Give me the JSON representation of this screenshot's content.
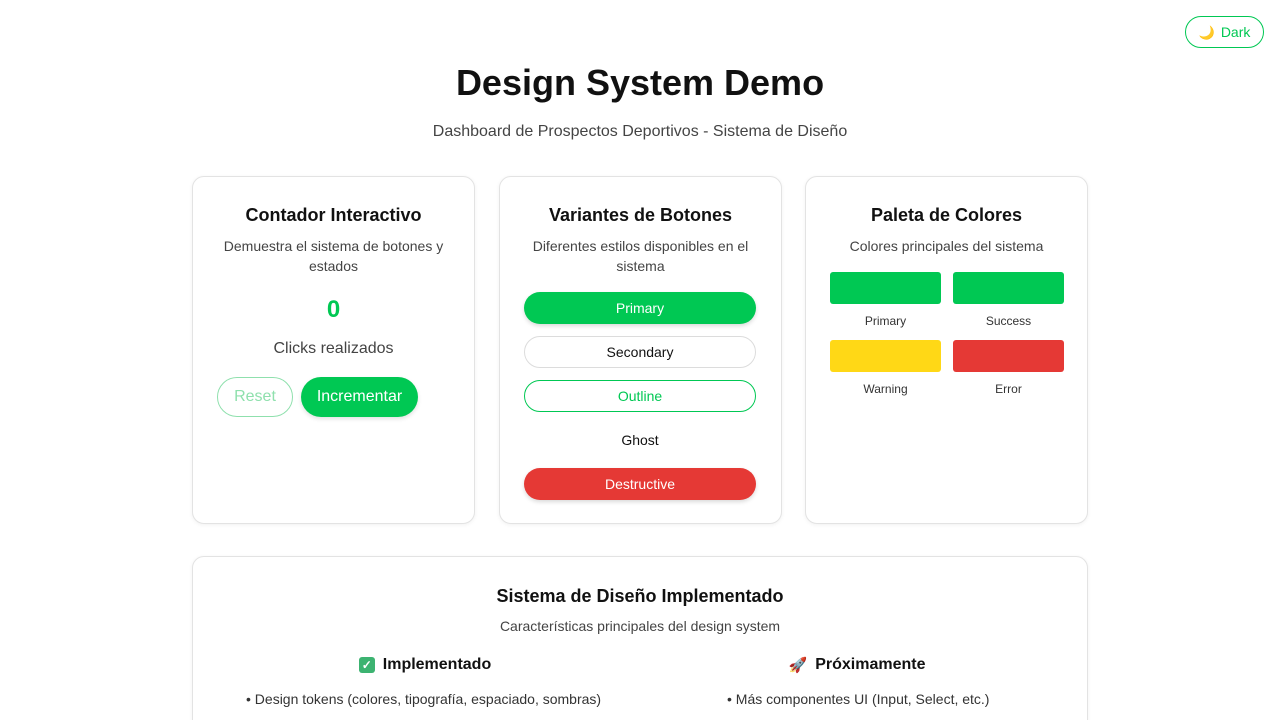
{
  "theme_toggle": {
    "icon": "moon-icon",
    "label": "Dark",
    "accent": "#00c853"
  },
  "header": {
    "title": "Design System Demo",
    "subtitle": "Dashboard de Prospectos Deportivos - Sistema de Diseño"
  },
  "counter_card": {
    "title": "Contador Interactivo",
    "description": "Demuestra el sistema de botones y estados",
    "value": "0",
    "value_label": "Clicks realizados",
    "reset_label": "Reset",
    "increment_label": "Incrementar"
  },
  "variants_card": {
    "title": "Variantes de Botones",
    "description": "Diferentes estilos disponibles en el sistema",
    "buttons": [
      {
        "label": "Primary"
      },
      {
        "label": "Secondary"
      },
      {
        "label": "Outline"
      },
      {
        "label": "Ghost"
      },
      {
        "label": "Destructive"
      }
    ]
  },
  "palette_card": {
    "title": "Paleta de Colores",
    "description": "Colores principales del sistema",
    "swatches": [
      {
        "name": "Primary",
        "color": "#00c853"
      },
      {
        "name": "Success",
        "color": "#00c853"
      },
      {
        "name": "Warning",
        "color": "#ffd816"
      },
      {
        "name": "Error",
        "color": "#e53935"
      }
    ]
  },
  "system_card": {
    "title": "Sistema de Diseño Implementado",
    "description": "Características principales del design system",
    "implemented": {
      "icon": "check-mark-icon",
      "heading": "Implementado",
      "items": [
        "• Design tokens (colores, tipografía, espaciado, sombras)"
      ]
    },
    "upcoming": {
      "icon": "rocket-icon",
      "heading": "Próximamente",
      "items": [
        "• Más componentes UI (Input, Select, etc.)"
      ]
    }
  }
}
